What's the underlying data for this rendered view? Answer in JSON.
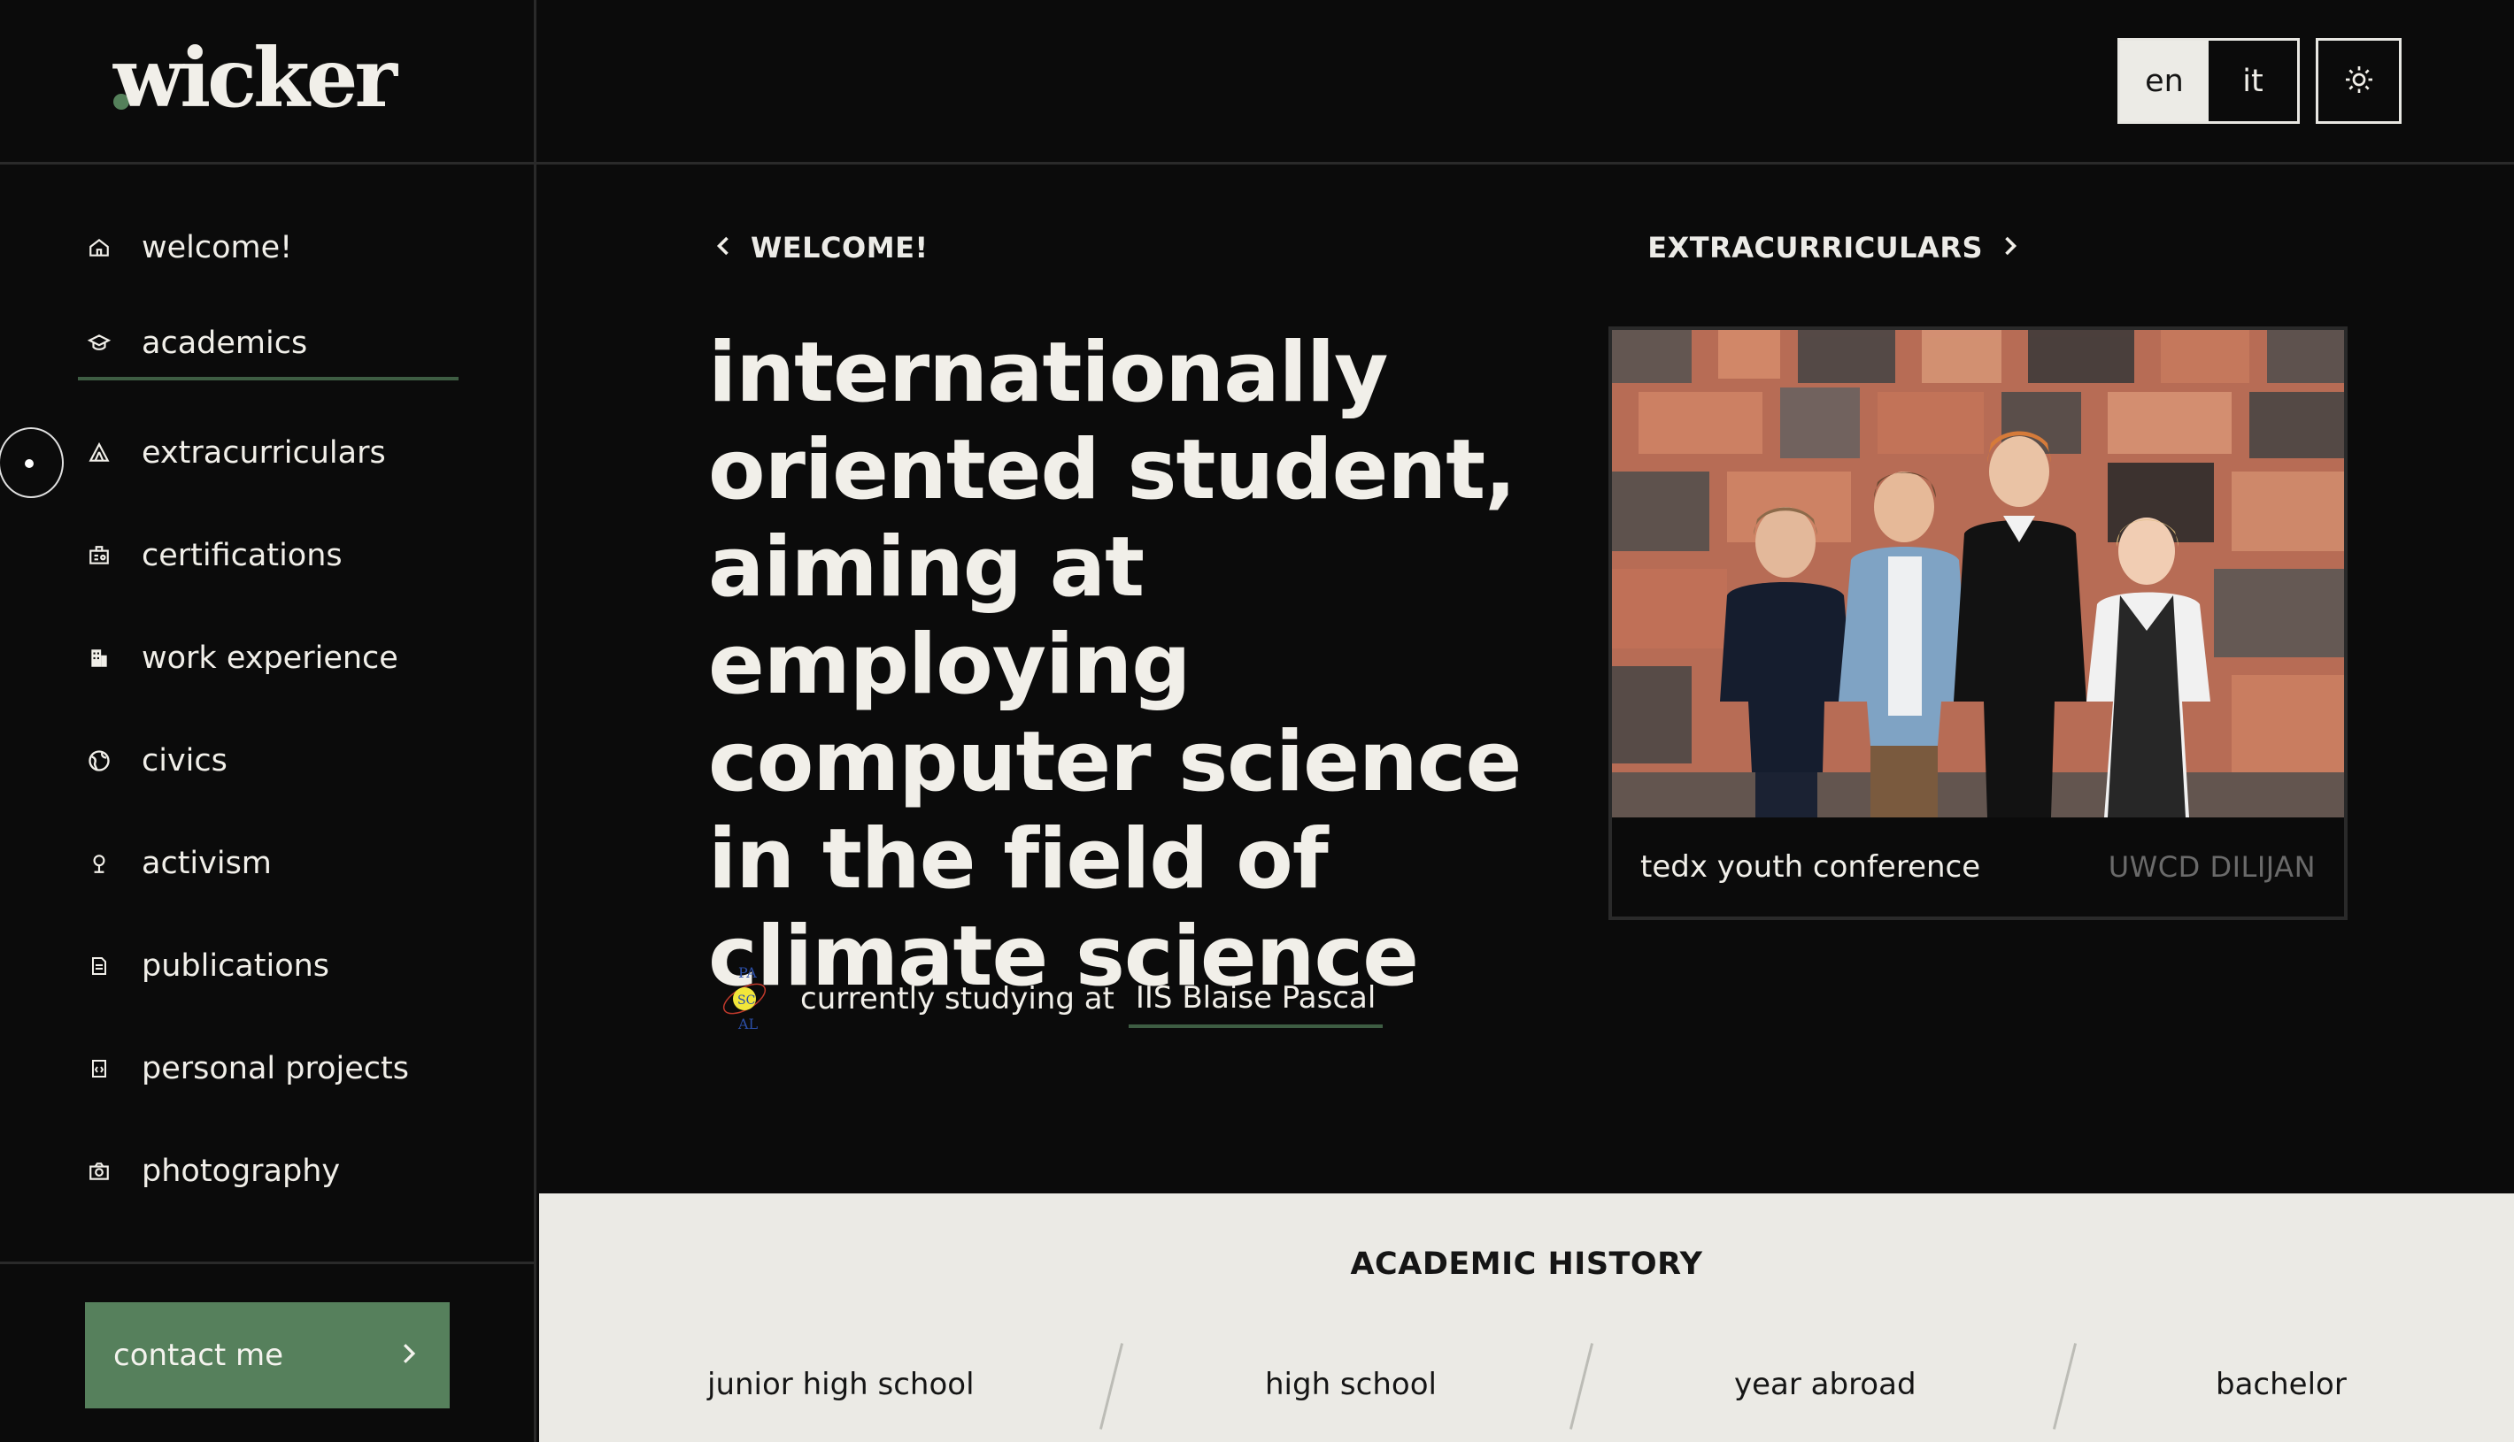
{
  "brand": {
    "logo_text": "wicker",
    "accent": "#56805c"
  },
  "sidebar": {
    "items": [
      {
        "label": "welcome!",
        "icon": "home-icon"
      },
      {
        "label": "academics",
        "icon": "graduation-cap-icon",
        "active": true
      },
      {
        "label": "extracurriculars",
        "icon": "tent-icon"
      },
      {
        "label": "certifications",
        "icon": "certificate-icon"
      },
      {
        "label": "work experience",
        "icon": "building-icon"
      },
      {
        "label": "civics",
        "icon": "globe-icon"
      },
      {
        "label": "activism",
        "icon": "tree-icon"
      },
      {
        "label": "publications",
        "icon": "document-icon"
      },
      {
        "label": "personal projects",
        "icon": "code-file-icon"
      },
      {
        "label": "photography",
        "icon": "camera-icon"
      }
    ],
    "contact_label": "contact me"
  },
  "header": {
    "languages": [
      {
        "label": "en",
        "selected": true
      },
      {
        "label": "it",
        "selected": false
      }
    ],
    "theme_icon": "sun-icon"
  },
  "main": {
    "prev_label": "WELCOME!",
    "next_label": "EXTRACURRICULARS",
    "headline": "internationally oriented student, aiming at employing computer science in the field of climate science",
    "studying_prefix": "currently studying at",
    "school_name": "IIS Blaise Pascal",
    "school_logo_text": "PA SC AL",
    "photo": {
      "caption": "tedx youth conference",
      "place": "UWCD DILIJAN"
    }
  },
  "history": {
    "title": "ACADEMIC HISTORY",
    "stages": [
      "junior high school",
      "high school",
      "year abroad",
      "bachelor"
    ]
  }
}
